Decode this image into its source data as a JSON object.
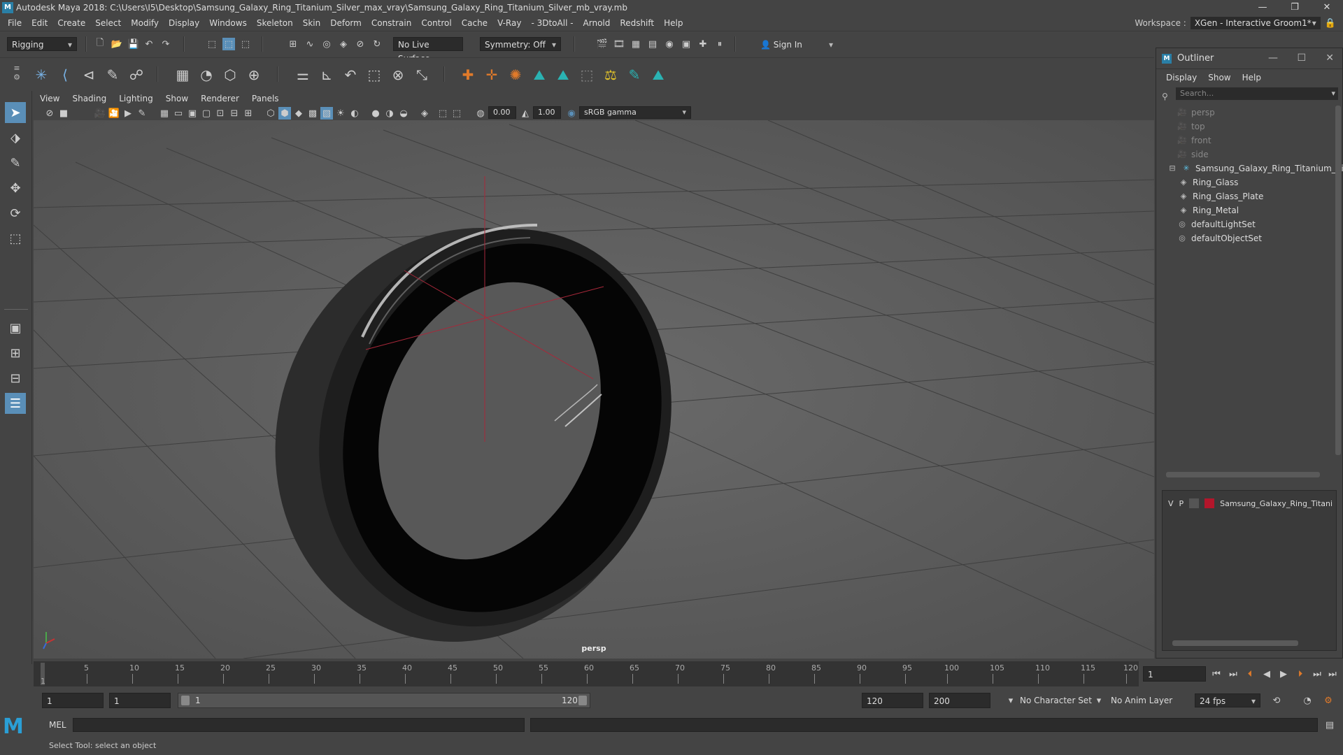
{
  "app": {
    "logo": "M",
    "title": "Autodesk Maya 2018: C:\\Users\\I5\\Desktop\\Samsung_Galaxy_Ring_Titanium_Silver_max_vray\\Samsung_Galaxy_Ring_Titanium_Silver_mb_vray.mb",
    "window_buttons": [
      "—",
      "❐",
      "✕"
    ]
  },
  "menubar": {
    "items": [
      "File",
      "Edit",
      "Create",
      "Select",
      "Modify",
      "Display",
      "Windows",
      "Skeleton",
      "Skin",
      "Deform",
      "Constrain",
      "Control",
      "Cache",
      "V-Ray",
      "- 3DtoAll -",
      "Arnold",
      "Redshift",
      "Help"
    ],
    "workspace_label": "Workspace :",
    "workspace_value": "XGen - Interactive Groom1*"
  },
  "statusline": {
    "mode": "Rigging",
    "live_surface": "No Live Surface",
    "symmetry": "Symmetry: Off",
    "sign_in": "Sign In"
  },
  "viewport": {
    "menus": [
      "View",
      "Shading",
      "Lighting",
      "Show",
      "Renderer",
      "Panels"
    ],
    "exposure": "0.00",
    "gamma": "1.00",
    "color_space": "sRGB gamma",
    "camera_label": "persp"
  },
  "timeline": {
    "ticks": [
      1,
      5,
      10,
      15,
      20,
      25,
      30,
      35,
      40,
      45,
      50,
      55,
      60,
      65,
      70,
      75,
      80,
      85,
      90,
      95,
      100,
      105,
      110,
      115,
      120
    ],
    "current_frame": "1"
  },
  "range": {
    "start": "1",
    "start_playback": "1",
    "slider_start": "1",
    "slider_end": "120",
    "end_playback": "120",
    "end": "200",
    "character_set": "No Character Set",
    "anim_layer": "No Anim Layer",
    "fps": "24 fps"
  },
  "commandline": {
    "label": "MEL"
  },
  "helpline": {
    "text": "Select Tool: select an object"
  },
  "outliner": {
    "title": "Outliner",
    "menus": [
      "Display",
      "Show",
      "Help"
    ],
    "search_placeholder": "Search...",
    "cameras": [
      "persp",
      "top",
      "front",
      "side"
    ],
    "group": "Samsung_Galaxy_Ring_Titanium_Silver",
    "children": [
      "Ring_Glass",
      "Ring_Glass_Plate",
      "Ring_Metal"
    ],
    "sets": [
      "defaultLightSet",
      "defaultObjectSet"
    ],
    "layer": {
      "v": "V",
      "p": "P",
      "name": "Samsung_Galaxy_Ring_Titanium_Silver",
      "color": "#b3162b"
    }
  }
}
